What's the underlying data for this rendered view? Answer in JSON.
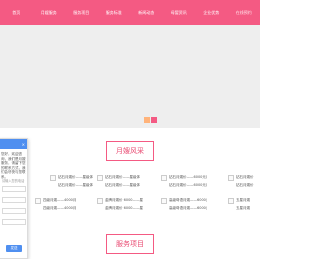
{
  "nav": {
    "items": [
      "首页",
      "月嫂服务",
      "服务项目",
      "服务标准",
      "新闻动态",
      "母婴资讯",
      "企业优势",
      "在线预约",
      "公司简介"
    ]
  },
  "section1": {
    "title": "月嫂风采"
  },
  "section2": {
    "title": "服务项目"
  },
  "grid": {
    "row1": [
      {
        "line1": "",
        "line2": ""
      },
      {
        "line1": "钻石月嫂价——星级体",
        "line2": "钻石月嫂价——星级体"
      },
      {
        "line1": "钻石月嫂价——星级体",
        "line2": "钻石月嫂价——星级体"
      },
      {
        "line1": "钻石月嫂价——6000元月",
        "line2": "钻石月嫂价——6000元月"
      },
      {
        "line1": "钻石月嫂价",
        "line2": "钻石月嫂价"
      }
    ],
    "row2": [
      {
        "line1": "",
        "line2": ""
      },
      {
        "line1": "四级月嫂——4000月",
        "line2": "四级月嫂——4000月"
      },
      {
        "line1": "金牌月嫂价 6000——星级体",
        "line2": "金牌月嫂价 6000——星级体"
      },
      {
        "line1": "高级母语月嫂——6000元月",
        "line2": "高级母语月嫂——6000元月"
      },
      {
        "line1": "五星月嫂",
        "line2": "五星月嫂"
      }
    ]
  },
  "chat": {
    "close": "×",
    "text": "您好，欢迎咨询，我们是月嫂服务，请留下您的联系方式，我们会尽快与您联系。",
    "placeholder": "请输入您的电话",
    "send": "发送"
  },
  "colors": {
    "brand": "#f45a83",
    "chat_blue": "#4f8ff0"
  }
}
